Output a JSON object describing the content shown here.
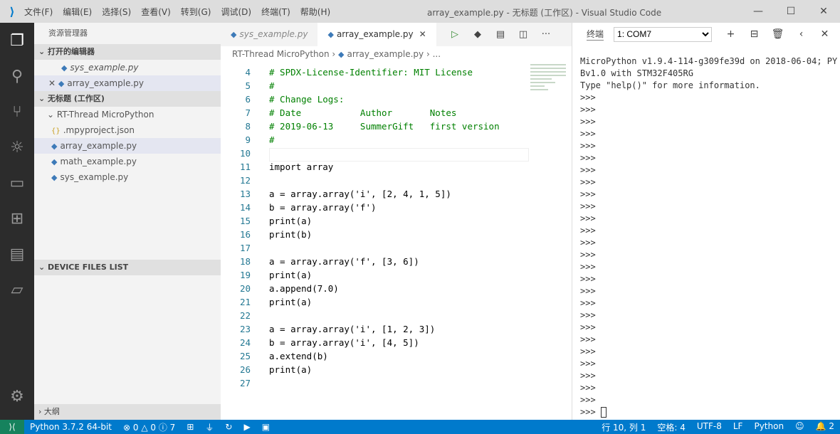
{
  "titlebar": {
    "menu": [
      "文件(F)",
      "编辑(E)",
      "选择(S)",
      "查看(V)",
      "转到(G)",
      "调试(D)",
      "终端(T)",
      "帮助(H)"
    ],
    "title": "array_example.py - 无标题 (工作区) - Visual Studio Code"
  },
  "sidebar": {
    "title": "资源管理器",
    "open_editors": "打开的编辑器",
    "open_files": [
      "sys_example.py",
      "array_example.py"
    ],
    "workspace": "无标题 (工作区)",
    "folder": "RT-Thread MicroPython",
    "files": [
      ".mpyproject.json",
      "array_example.py",
      "math_example.py",
      "sys_example.py"
    ],
    "device_files": "DEVICE FILES LIST",
    "outline": "大纲"
  },
  "editor": {
    "tabs": [
      "sys_example.py",
      "array_example.py"
    ],
    "breadcrumb": [
      "RT-Thread MicroPython",
      "array_example.py",
      "..."
    ],
    "lines": [
      {
        "n": "4",
        "t": "# SPDX-License-Identifier: MIT License"
      },
      {
        "n": "5",
        "t": "#"
      },
      {
        "n": "6",
        "t": "# Change Logs:"
      },
      {
        "n": "7",
        "t": "# Date           Author       Notes"
      },
      {
        "n": "8",
        "t": "# 2019-06-13     SummerGift   first version"
      },
      {
        "n": "9",
        "t": "#"
      },
      {
        "n": "10",
        "t": ""
      },
      {
        "n": "11",
        "t": "import array"
      },
      {
        "n": "12",
        "t": ""
      },
      {
        "n": "13",
        "t": "a = array.array('i', [2, 4, 1, 5])"
      },
      {
        "n": "14",
        "t": "b = array.array('f')"
      },
      {
        "n": "15",
        "t": "print(a)"
      },
      {
        "n": "16",
        "t": "print(b)"
      },
      {
        "n": "17",
        "t": ""
      },
      {
        "n": "18",
        "t": "a = array.array('f', [3, 6])"
      },
      {
        "n": "19",
        "t": "print(a)"
      },
      {
        "n": "20",
        "t": "a.append(7.0)"
      },
      {
        "n": "21",
        "t": "print(a)"
      },
      {
        "n": "22",
        "t": ""
      },
      {
        "n": "23",
        "t": "a = array.array('i', [1, 2, 3])"
      },
      {
        "n": "24",
        "t": "b = array.array('i', [4, 5])"
      },
      {
        "n": "25",
        "t": "a.extend(b)"
      },
      {
        "n": "26",
        "t": "print(a)"
      },
      {
        "n": "27",
        "t": ""
      }
    ]
  },
  "terminal": {
    "label": "终端",
    "selected": "1: COM7",
    "banner": "MicroPython v1.9.4-114-g309fe39d on 2018-06-04; PY\nBv1.0 with STM32F405RG\nType \"help()\" for more information.",
    "prompt": ">>>",
    "prompt_count": 26
  },
  "status": {
    "python": "Python 3.7.2 64-bit",
    "errors": "0",
    "warnings": "0",
    "infos": "7",
    "position": "行 10, 列 1",
    "spaces": "空格: 4",
    "encoding": "UTF-8",
    "eol": "LF",
    "language": "Python",
    "notifications": "2"
  }
}
